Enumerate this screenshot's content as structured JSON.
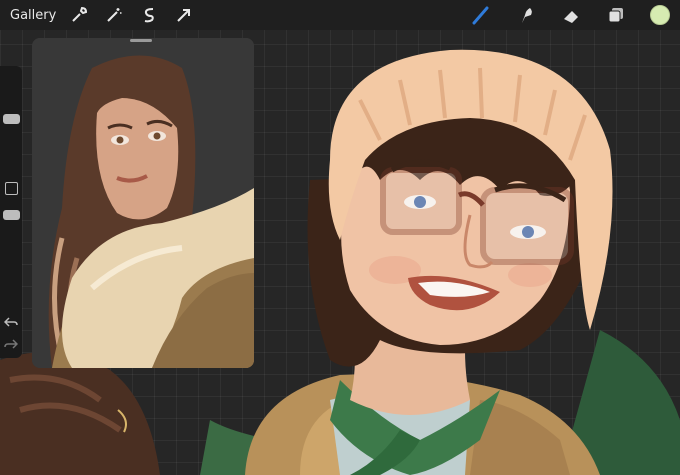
{
  "toolbar": {
    "gallery_label": "Gallery",
    "left_tools": [
      {
        "icon": "wrench-icon",
        "name": "actions"
      },
      {
        "icon": "magic-wand-icon",
        "name": "adjustments"
      },
      {
        "icon": "selection-s-icon",
        "name": "selection"
      },
      {
        "icon": "arrow-cursor-icon",
        "name": "transform"
      }
    ],
    "right_tools": [
      {
        "icon": "brush-icon",
        "name": "paint"
      },
      {
        "icon": "smudge-icon",
        "name": "smudge"
      },
      {
        "icon": "eraser-icon",
        "name": "eraser"
      },
      {
        "icon": "layers-icon",
        "name": "layers"
      }
    ],
    "active_color": "#d6ebb1",
    "active_tool_color": "#2f7bd9"
  },
  "sidebar": {
    "controls": [
      "brush-size-slider",
      "modify-button",
      "opacity-slider",
      "undo-button",
      "redo-button"
    ]
  },
  "reference": {
    "panel": "reference-image-window"
  }
}
